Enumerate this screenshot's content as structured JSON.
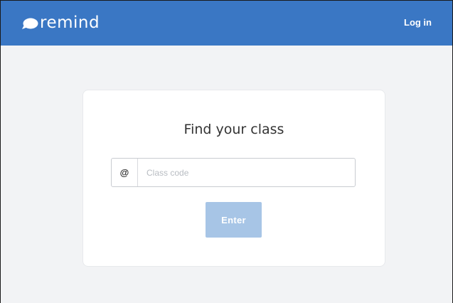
{
  "header": {
    "brand": "remind",
    "login_label": "Log in",
    "background_color": "#3a77c4"
  },
  "card": {
    "title": "Find your class",
    "input": {
      "prefix": "@",
      "placeholder": "Class code",
      "value": ""
    },
    "enter_button": {
      "label": "Enter",
      "color": "#a7c5e6"
    }
  },
  "icons": {
    "logo": "speech-bubble-icon"
  }
}
